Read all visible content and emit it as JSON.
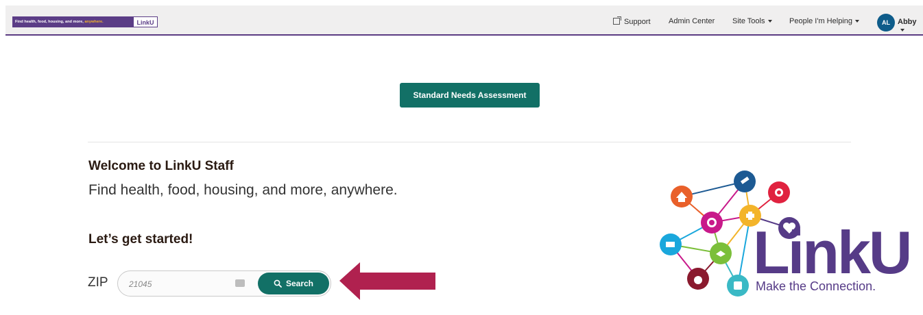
{
  "header": {
    "tagline_part1": "Find health, food, housing, and more, ",
    "tagline_highlight": "anywhere.",
    "logo_text": "LinkU",
    "nav": {
      "support": "Support",
      "admin_center": "Admin Center",
      "site_tools": "Site Tools",
      "people_helping": "People I'm Helping",
      "avatar_initials": "AL",
      "user_name": "Abby"
    }
  },
  "main": {
    "assessment_button": "Standard Needs Assessment",
    "welcome_title": "Welcome to LinkU Staff",
    "welcome_subtitle": "Find health, food, housing, and more, anywhere.",
    "started_heading": "Let’s get started!",
    "zip_label": "ZIP",
    "zip_placeholder": "21045",
    "search_button": "Search"
  },
  "brand_panel": {
    "logo_text": "LinkU",
    "tagline": "Make the Connection."
  },
  "icons": {
    "support": "external-link-icon",
    "search": "magnifier-icon",
    "keyboard": "keyboard-icon",
    "arrow": "left-arrow-icon"
  },
  "colors": {
    "brand_purple": "#5b3d86",
    "accent_teal": "#127066",
    "arrow_red": "#b0214f",
    "header_bg": "#f0efef"
  }
}
